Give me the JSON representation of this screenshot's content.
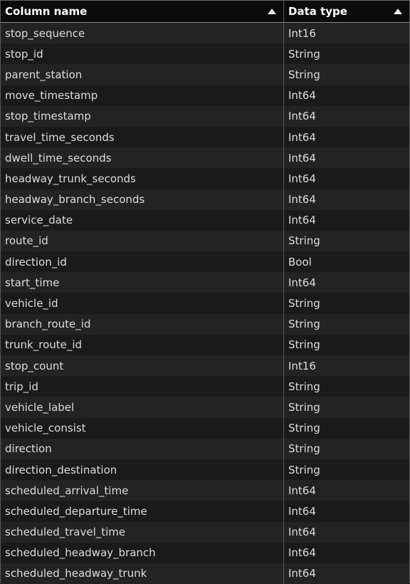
{
  "header": {
    "column_name_label": "Column name",
    "data_type_label": "Data type",
    "sort_icon": "triangle-up-icon"
  },
  "rows": [
    {
      "name": "stop_sequence",
      "type": "Int16"
    },
    {
      "name": "stop_id",
      "type": "String"
    },
    {
      "name": "parent_station",
      "type": "String"
    },
    {
      "name": "move_timestamp",
      "type": "Int64"
    },
    {
      "name": "stop_timestamp",
      "type": "Int64"
    },
    {
      "name": "travel_time_seconds",
      "type": "Int64"
    },
    {
      "name": "dwell_time_seconds",
      "type": "Int64"
    },
    {
      "name": "headway_trunk_seconds",
      "type": "Int64"
    },
    {
      "name": "headway_branch_seconds",
      "type": "Int64"
    },
    {
      "name": "service_date",
      "type": "Int64"
    },
    {
      "name": "route_id",
      "type": "String"
    },
    {
      "name": "direction_id",
      "type": "Bool"
    },
    {
      "name": "start_time",
      "type": "Int64"
    },
    {
      "name": "vehicle_id",
      "type": "String"
    },
    {
      "name": "branch_route_id",
      "type": "String"
    },
    {
      "name": "trunk_route_id",
      "type": "String"
    },
    {
      "name": "stop_count",
      "type": "Int16"
    },
    {
      "name": "trip_id",
      "type": "String"
    },
    {
      "name": "vehicle_label",
      "type": "String"
    },
    {
      "name": "vehicle_consist",
      "type": "String"
    },
    {
      "name": "direction",
      "type": "String"
    },
    {
      "name": "direction_destination",
      "type": "String"
    },
    {
      "name": "scheduled_arrival_time",
      "type": "Int64"
    },
    {
      "name": "scheduled_departure_time",
      "type": "Int64"
    },
    {
      "name": "scheduled_travel_time",
      "type": "Int64"
    },
    {
      "name": "scheduled_headway_branch",
      "type": "Int64"
    },
    {
      "name": "scheduled_headway_trunk",
      "type": "Int64"
    }
  ]
}
